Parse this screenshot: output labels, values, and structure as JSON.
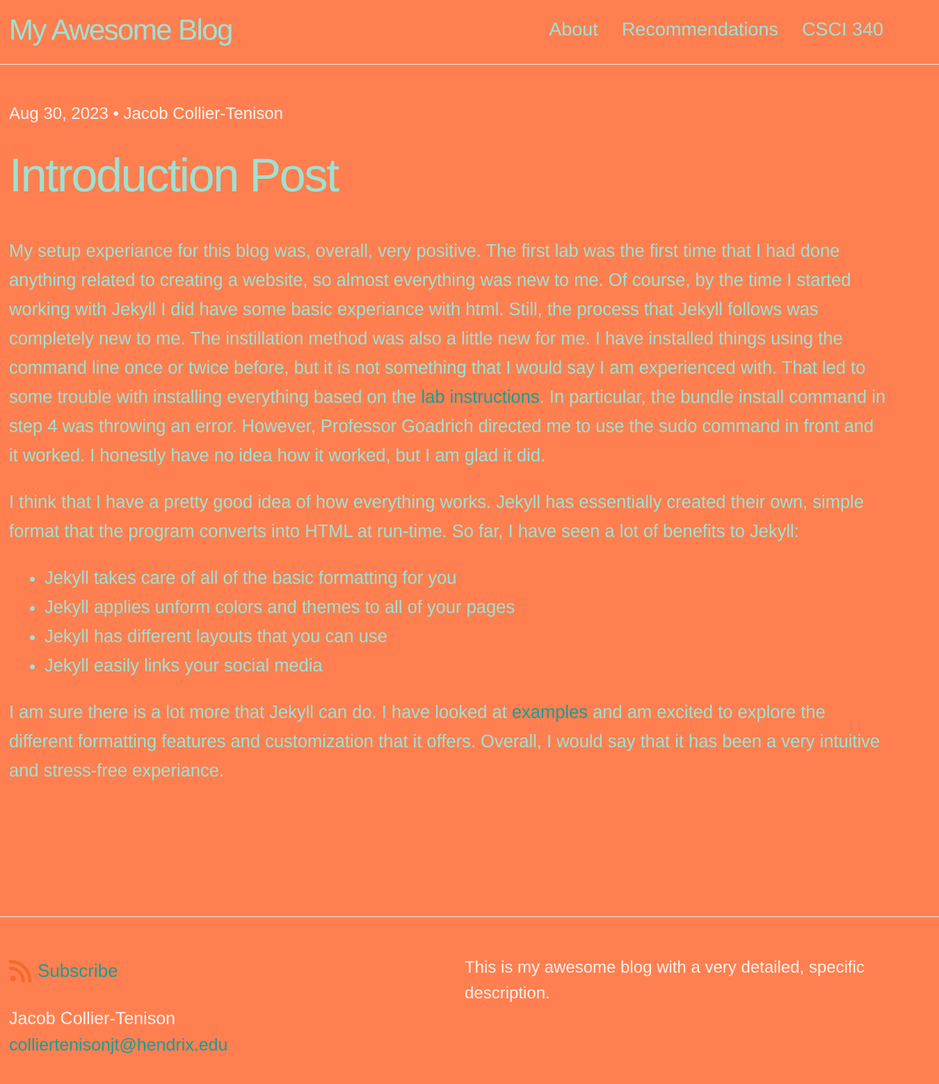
{
  "site": {
    "title": "My Awesome Blog",
    "nav": [
      {
        "label": "About"
      },
      {
        "label": "Recommendations"
      },
      {
        "label": "CSCI 340"
      }
    ]
  },
  "post": {
    "date": "Aug 30, 2023",
    "separator": "•",
    "author": "Jacob Collier-Tenison",
    "title": "Introduction Post",
    "p1_before": "My setup experiance for this blog was, overall, very positive. The first lab was the first time that I had done anything related to creating a website, so almost everything was new to me. Of course, by the time I started working with Jekyll I did have some basic experiance with html. Still, the process that Jekyll follows was completely new to me. The instillation method was also a little new for me. I have installed things using the command line once or twice before, but it is not something that I would say I am experienced with. That led to some trouble with installing everything based on the ",
    "p1_link": "lab instructions",
    "p1_after": ". In particular, the bundle install command in step 4 was throwing an error. However, Professor Goadrich directed me to use the sudo command in front and it worked. I honestly have no idea how it worked, but I am glad it did.",
    "p2": "I think that I have a pretty good idea of how everything works. Jekyll has essentially created their own, simple format that the program converts into HTML at run-time. So far, I have seen a lot of benefits to Jekyll:",
    "list": [
      "Jekyll takes care of all of the basic formatting for you",
      "Jekyll applies unform colors and themes to all of your pages",
      "Jekyll has different layouts that you can use",
      "Jekyll easily links your social media"
    ],
    "p3_before": "I am sure there is a lot more that Jekyll can do. I have looked at ",
    "p3_link": "examples",
    "p3_after": " and am excited to explore the different formatting features and customization that it offers. Overall, I would say that it has been a very intuitive and stress-free experiance."
  },
  "footer": {
    "subscribe_label": "Subscribe",
    "subscribe_icon": "rss-icon",
    "name": "Jacob Collier-Tenison",
    "email": "colliertenisonjt@hendrix.edu",
    "description": "This is my awesome blog with a very detailed, specific description."
  },
  "colors": {
    "background": "#FF7F50",
    "text": "#9FE0D2",
    "link": "#1B9C95",
    "meta_text": "#FBF1EA",
    "rss_icon": "#F26B2D"
  }
}
